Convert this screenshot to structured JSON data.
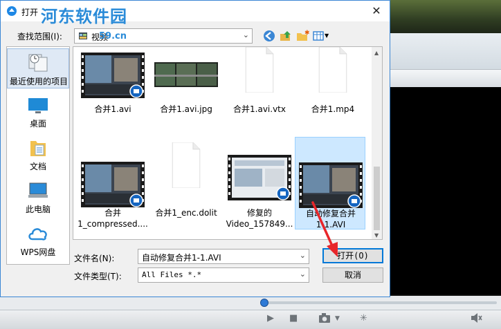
{
  "dialog": {
    "title": "打开",
    "watermark": "河东软件园",
    "watermark_url": "59.cn",
    "close_symbol": "✕"
  },
  "lookin": {
    "label": "查找范围(I):",
    "value": "视频"
  },
  "places": [
    {
      "label": "最近使用的项目",
      "icon": "recent-places-icon"
    },
    {
      "label": "桌面",
      "icon": "desktop-icon"
    },
    {
      "label": "文档",
      "icon": "documents-icon"
    },
    {
      "label": "此电脑",
      "icon": "this-pc-icon"
    },
    {
      "label": "WPS网盘",
      "icon": "cloud-icon"
    }
  ],
  "files": [
    {
      "line1": "合并1.avi",
      "line2": "",
      "kind": "video"
    },
    {
      "line1": "合并1.avi.jpg",
      "line2": "",
      "kind": "image"
    },
    {
      "line1": "合并1.avi.vtx",
      "line2": "",
      "kind": "blank"
    },
    {
      "line1": "合并1.mp4",
      "line2": "",
      "kind": "blank"
    },
    {
      "line1": "合并",
      "line2": "1_compressed....",
      "kind": "video"
    },
    {
      "line1": "合并1_enc.dolit",
      "line2": "",
      "kind": "blank"
    },
    {
      "line1": "修复的",
      "line2": "Video_157849...",
      "kind": "video-screen"
    },
    {
      "line1": "自动修复合并",
      "line2": "1-1.AVI",
      "kind": "video",
      "selected": true
    }
  ],
  "filename": {
    "label": "文件名(N):",
    "value": "自动修复合并1-1.AVI"
  },
  "filetype": {
    "label": "文件类型(T):",
    "value": "All Files *.*"
  },
  "buttons": {
    "open": "打开(O)",
    "cancel": "取消"
  },
  "colors": {
    "accent": "#0078d7",
    "selection": "#cde8ff",
    "arrow": "#e8262a"
  }
}
